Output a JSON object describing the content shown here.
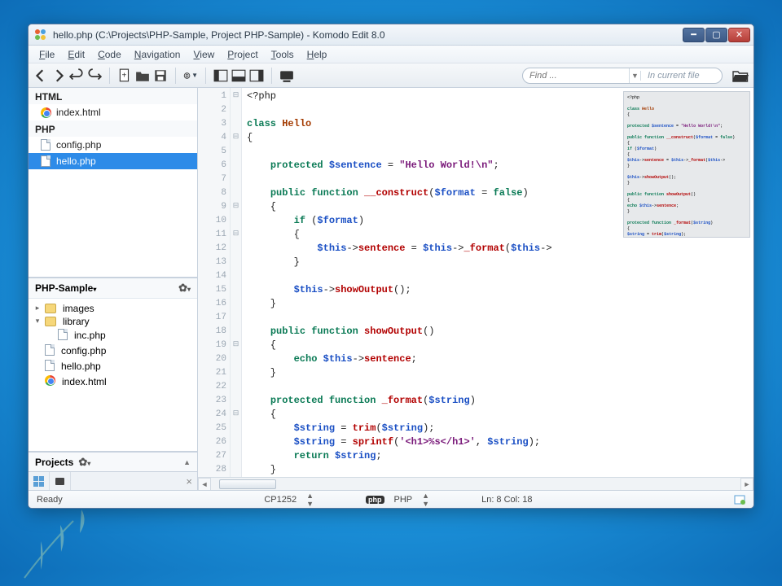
{
  "window": {
    "title": "hello.php (C:\\Projects\\PHP-Sample, Project PHP-Sample) - Komodo Edit 8.0"
  },
  "menu": {
    "items": [
      "File",
      "Edit",
      "Code",
      "Navigation",
      "View",
      "Project",
      "Tools",
      "Help"
    ]
  },
  "find": {
    "placeholder": "Find ...",
    "scope": "In current file"
  },
  "sidebar": {
    "openfiles": {
      "groups": [
        {
          "label": "HTML",
          "items": [
            {
              "name": "index.html",
              "kind": "chrome"
            }
          ]
        },
        {
          "label": "PHP",
          "items": [
            {
              "name": "config.php",
              "kind": "doc"
            },
            {
              "name": "hello.php",
              "kind": "doc",
              "selected": true
            }
          ]
        }
      ]
    },
    "project": {
      "name": "PHP-Sample",
      "tree": [
        {
          "kind": "folder",
          "name": "images",
          "expanded": false,
          "depth": 0
        },
        {
          "kind": "folder",
          "name": "library",
          "expanded": true,
          "depth": 0
        },
        {
          "kind": "file",
          "name": "inc.php",
          "depth": 1,
          "icon": "doc"
        },
        {
          "kind": "file",
          "name": "config.php",
          "depth": 0,
          "icon": "doc"
        },
        {
          "kind": "file",
          "name": "hello.php",
          "depth": 0,
          "icon": "doc"
        },
        {
          "kind": "file",
          "name": "index.html",
          "depth": 0,
          "icon": "chrome"
        }
      ]
    },
    "projects_label": "Projects"
  },
  "editor": {
    "lines": [
      {
        "n": 1,
        "fold": "-",
        "html": "&lt;?php"
      },
      {
        "n": 2,
        "fold": "",
        "html": ""
      },
      {
        "n": 3,
        "fold": "",
        "html": "<span class='kw'>class</span> <span class='cl'>Hello</span>"
      },
      {
        "n": 4,
        "fold": "-",
        "html": "{"
      },
      {
        "n": 5,
        "fold": "",
        "html": ""
      },
      {
        "n": 6,
        "fold": "",
        "html": "    <span class='kw'>protected</span> <span class='var'>$sentence</span> = <span class='str'>\"Hello World!\\n\"</span>;"
      },
      {
        "n": 7,
        "fold": "",
        "html": ""
      },
      {
        "n": 8,
        "fold": "",
        "html": "    <span class='kw'>public function</span> <span class='fn'>__construct</span>(<span class='var'>$format</span> = <span class='kw'>false</span>)"
      },
      {
        "n": 9,
        "fold": "-",
        "html": "    {"
      },
      {
        "n": 10,
        "fold": "",
        "html": "        <span class='kw'>if</span> (<span class='var'>$format</span>)"
      },
      {
        "n": 11,
        "fold": "-",
        "html": "        {"
      },
      {
        "n": 12,
        "fold": "",
        "html": "            <span class='var'>$this</span>-&gt;<span class='fn'>sentence</span> = <span class='var'>$this</span>-&gt;<span class='fn'>_format</span>(<span class='var'>$this</span>-&gt;"
      },
      {
        "n": 13,
        "fold": "",
        "html": "        }"
      },
      {
        "n": 14,
        "fold": "",
        "html": ""
      },
      {
        "n": 15,
        "fold": "",
        "html": "        <span class='var'>$this</span>-&gt;<span class='fn'>showOutput</span>();"
      },
      {
        "n": 16,
        "fold": "",
        "html": "    }"
      },
      {
        "n": 17,
        "fold": "",
        "html": ""
      },
      {
        "n": 18,
        "fold": "",
        "html": "    <span class='kw'>public function</span> <span class='fn'>showOutput</span>()"
      },
      {
        "n": 19,
        "fold": "-",
        "html": "    {"
      },
      {
        "n": 20,
        "fold": "",
        "html": "        <span class='kw'>echo</span> <span class='var'>$this</span>-&gt;<span class='fn'>sentence</span>;"
      },
      {
        "n": 21,
        "fold": "",
        "html": "    }"
      },
      {
        "n": 22,
        "fold": "",
        "html": ""
      },
      {
        "n": 23,
        "fold": "",
        "html": "    <span class='kw'>protected function</span> <span class='fn'>_format</span>(<span class='var'>$string</span>)"
      },
      {
        "n": 24,
        "fold": "-",
        "html": "    {"
      },
      {
        "n": 25,
        "fold": "",
        "html": "        <span class='var'>$string</span> = <span class='fn'>trim</span>(<span class='var'>$string</span>);"
      },
      {
        "n": 26,
        "fold": "",
        "html": "        <span class='var'>$string</span> = <span class='fn'>sprintf</span>(<span class='str'>'&lt;h1&gt;%s&lt;/h1&gt;'</span>, <span class='var'>$string</span>);"
      },
      {
        "n": 27,
        "fold": "",
        "html": "        <span class='kw'>return</span> <span class='var'>$string</span>;"
      },
      {
        "n": 28,
        "fold": "",
        "html": "    }"
      }
    ]
  },
  "statusbar": {
    "ready": "Ready",
    "encoding": "CP1252",
    "lang_badge": "php",
    "lang": "PHP",
    "cursor": "Ln: 8 Col: 18"
  }
}
